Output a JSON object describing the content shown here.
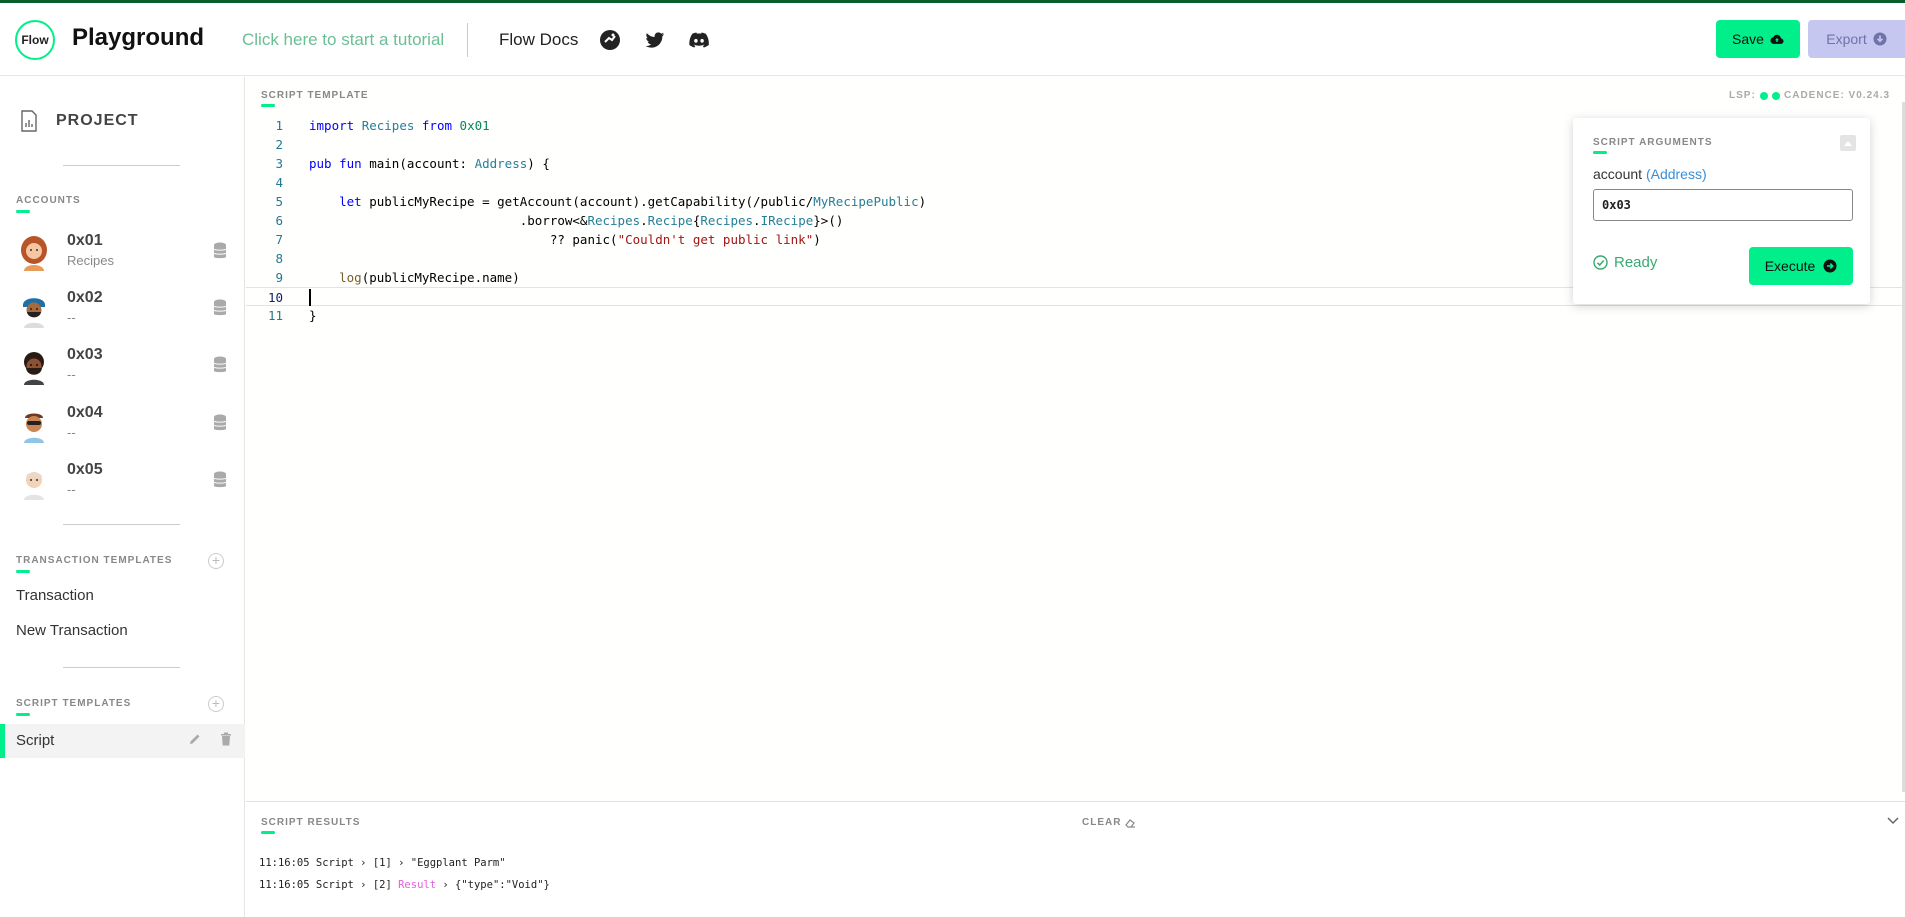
{
  "header": {
    "logo_text": "Flow",
    "brand": "Playground",
    "tutorial_link": "Click here to start a tutorial",
    "docs_link": "Flow Docs",
    "save_label": "Save",
    "export_label": "Export",
    "accent_color": "#00ef8b",
    "icons": [
      "flow-runner-icon",
      "twitter-icon",
      "discord-icon",
      "cloud-upload-icon",
      "download-circle-icon"
    ]
  },
  "sidebar": {
    "project_label": "PROJECT",
    "accounts_title": "ACCOUNTS",
    "accounts": [
      {
        "address": "0x01",
        "subtitle": "Recipes"
      },
      {
        "address": "0x02",
        "subtitle": "--"
      },
      {
        "address": "0x03",
        "subtitle": "--"
      },
      {
        "address": "0x04",
        "subtitle": "--"
      },
      {
        "address": "0x05",
        "subtitle": "--"
      }
    ],
    "transaction_templates_title": "TRANSACTION TEMPLATES",
    "transaction_templates": [
      "Transaction",
      "New Transaction"
    ],
    "script_templates_title": "SCRIPT TEMPLATES",
    "script_templates": [
      "Script"
    ]
  },
  "editor": {
    "title": "SCRIPT TEMPLATE",
    "lsp_label": "LSP:",
    "cadence_version": "CADENCE: V0.24.3",
    "line_numbers": [
      "1",
      "2",
      "3",
      "4",
      "5",
      "6",
      "7",
      "8",
      "9",
      "10",
      "11"
    ]
  },
  "args_panel": {
    "title": "SCRIPT ARGUMENTS",
    "arg_name": "account",
    "arg_type": "(Address)",
    "arg_value": "0x03",
    "status": "Ready",
    "execute_label": "Execute"
  },
  "results": {
    "title": "SCRIPT RESULTS",
    "clear_label": "CLEAR",
    "logs": [
      {
        "time": "11:16:05",
        "source": "Script",
        "index": "[1]",
        "tag": "",
        "message": "\"Eggplant Parm\""
      },
      {
        "time": "11:16:05",
        "source": "Script",
        "index": "[2]",
        "tag": "Result",
        "message": "{\"type\":\"Void\"}"
      }
    ]
  }
}
